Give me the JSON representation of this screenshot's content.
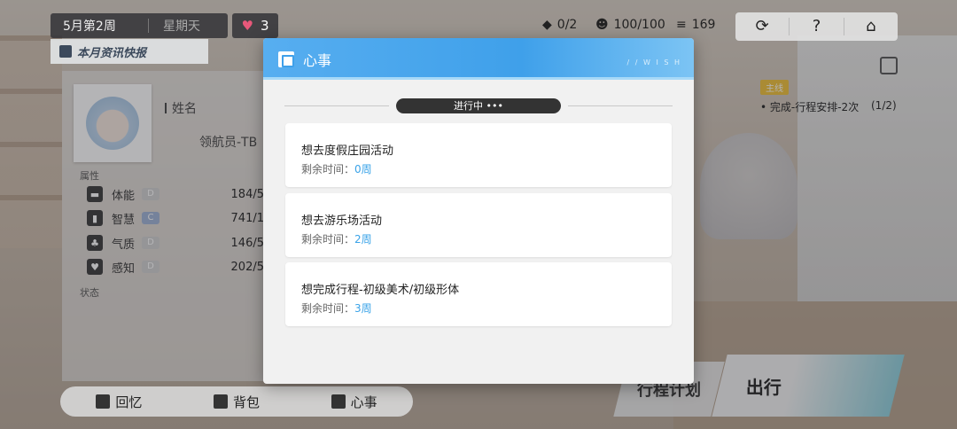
{
  "header": {
    "week": "5月第2周",
    "weekday": "星期天",
    "hearts": "3",
    "news_label": "本月资讯快报",
    "resources": [
      {
        "icon": "ticket-icon",
        "value": "0/2"
      },
      {
        "icon": "smile-icon",
        "value": "100/100"
      },
      {
        "icon": "coins-icon",
        "value": "169"
      }
    ],
    "buttons": [
      "refresh-icon",
      "help-icon",
      "home-icon"
    ]
  },
  "character": {
    "name_label": "姓名",
    "name_value": "领航员-TB",
    "attributes_label": "属性",
    "attributes": [
      {
        "name": "体能",
        "grade": "D",
        "value": "184/5"
      },
      {
        "name": "智慧",
        "grade": "C",
        "value": "741/1"
      },
      {
        "name": "气质",
        "grade": "D",
        "value": "146/5"
      },
      {
        "name": "感知",
        "grade": "D",
        "value": "202/5"
      }
    ],
    "status_label": "状态"
  },
  "quest": {
    "tag": "主线",
    "text": "• 完成-行程安排-2次",
    "count": "(1/2)"
  },
  "bottom_nav": [
    {
      "label": "回忆",
      "icon": "memory-icon"
    },
    {
      "label": "背包",
      "icon": "bag-icon"
    },
    {
      "label": "心事",
      "icon": "wish-icon"
    }
  ],
  "actions": {
    "plan": "行程计划",
    "go": "出行"
  },
  "modal": {
    "title": "心事",
    "subtitle": "/ / W I S H",
    "status_pill": "进行中 •••",
    "remaining_label": "剩余时间：",
    "wishes": [
      {
        "title": "想去度假庄园活动",
        "time": "0周"
      },
      {
        "title": "想去游乐场活动",
        "time": "2周"
      },
      {
        "title": "想完成行程-初级美术/初级形体",
        "time": "3周"
      }
    ]
  },
  "colors": {
    "accent": "#3fa0ea",
    "time_value": "#3aa3e8",
    "heart": "#e8587a",
    "quest_tag": "#f0c038"
  }
}
